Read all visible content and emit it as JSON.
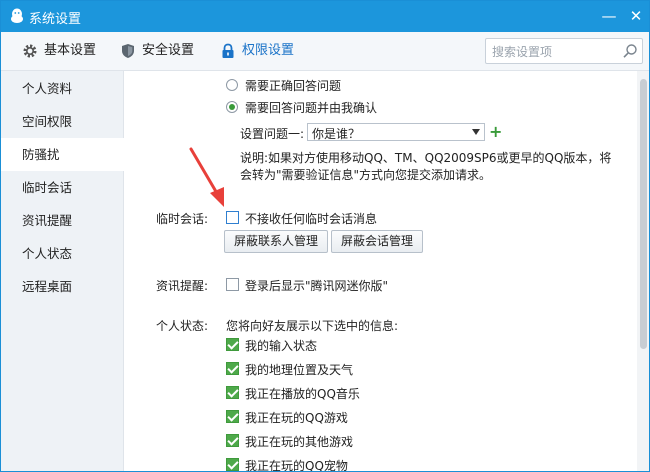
{
  "window": {
    "title": "系统设置",
    "minimize": "—",
    "close": "✕"
  },
  "toolbar": {
    "tabs": [
      {
        "label": "基本设置",
        "icon": "gear-icon"
      },
      {
        "label": "安全设置",
        "icon": "shield-icon"
      },
      {
        "label": "权限设置",
        "icon": "lock-icon",
        "active": true
      }
    ],
    "search_placeholder": "搜索设置项"
  },
  "sidebar": {
    "items": [
      {
        "label": "个人资料"
      },
      {
        "label": "空间权限"
      },
      {
        "label": "防骚扰",
        "active": true
      },
      {
        "label": "临时会话"
      },
      {
        "label": "资讯提醒"
      },
      {
        "label": "个人状态"
      },
      {
        "label": "远程桌面"
      }
    ]
  },
  "content": {
    "radio_option1": "需要正确回答问题",
    "radio_option2": "需要回答问题并由我确认",
    "question_label": "设置问题一:",
    "question_value": "你是谁？",
    "note_line1": "说明:如果对方使用移动QQ、TM、QQ2009SP6或更早的QQ版本，将",
    "note_line2": "会转为\"需要验证信息\"方式向您提交添加请求。",
    "temp_session_label": "临时会话:",
    "temp_session_option": "不接收任何临时会话消息",
    "btn_block_contacts": "屏蔽联系人管理",
    "btn_block_sessions": "屏蔽会话管理",
    "news_label": "资讯提醒:",
    "news_option": "登录后显示\"腾讯网迷你版\"",
    "status_label": "个人状态:",
    "status_intro": "您将向好友展示以下选中的信息:",
    "status_items": [
      "我的输入状态",
      "我的地理位置及天气",
      "我正在播放的QQ音乐",
      "我正在玩的QQ游戏",
      "我正在玩的其他游戏",
      "我正在玩的QQ宠物"
    ]
  },
  "colors": {
    "titlebar": "#1c96dc",
    "accent": "#1a73c8",
    "check": "#4ea94a",
    "annotation_arrow": "#e8403a"
  }
}
